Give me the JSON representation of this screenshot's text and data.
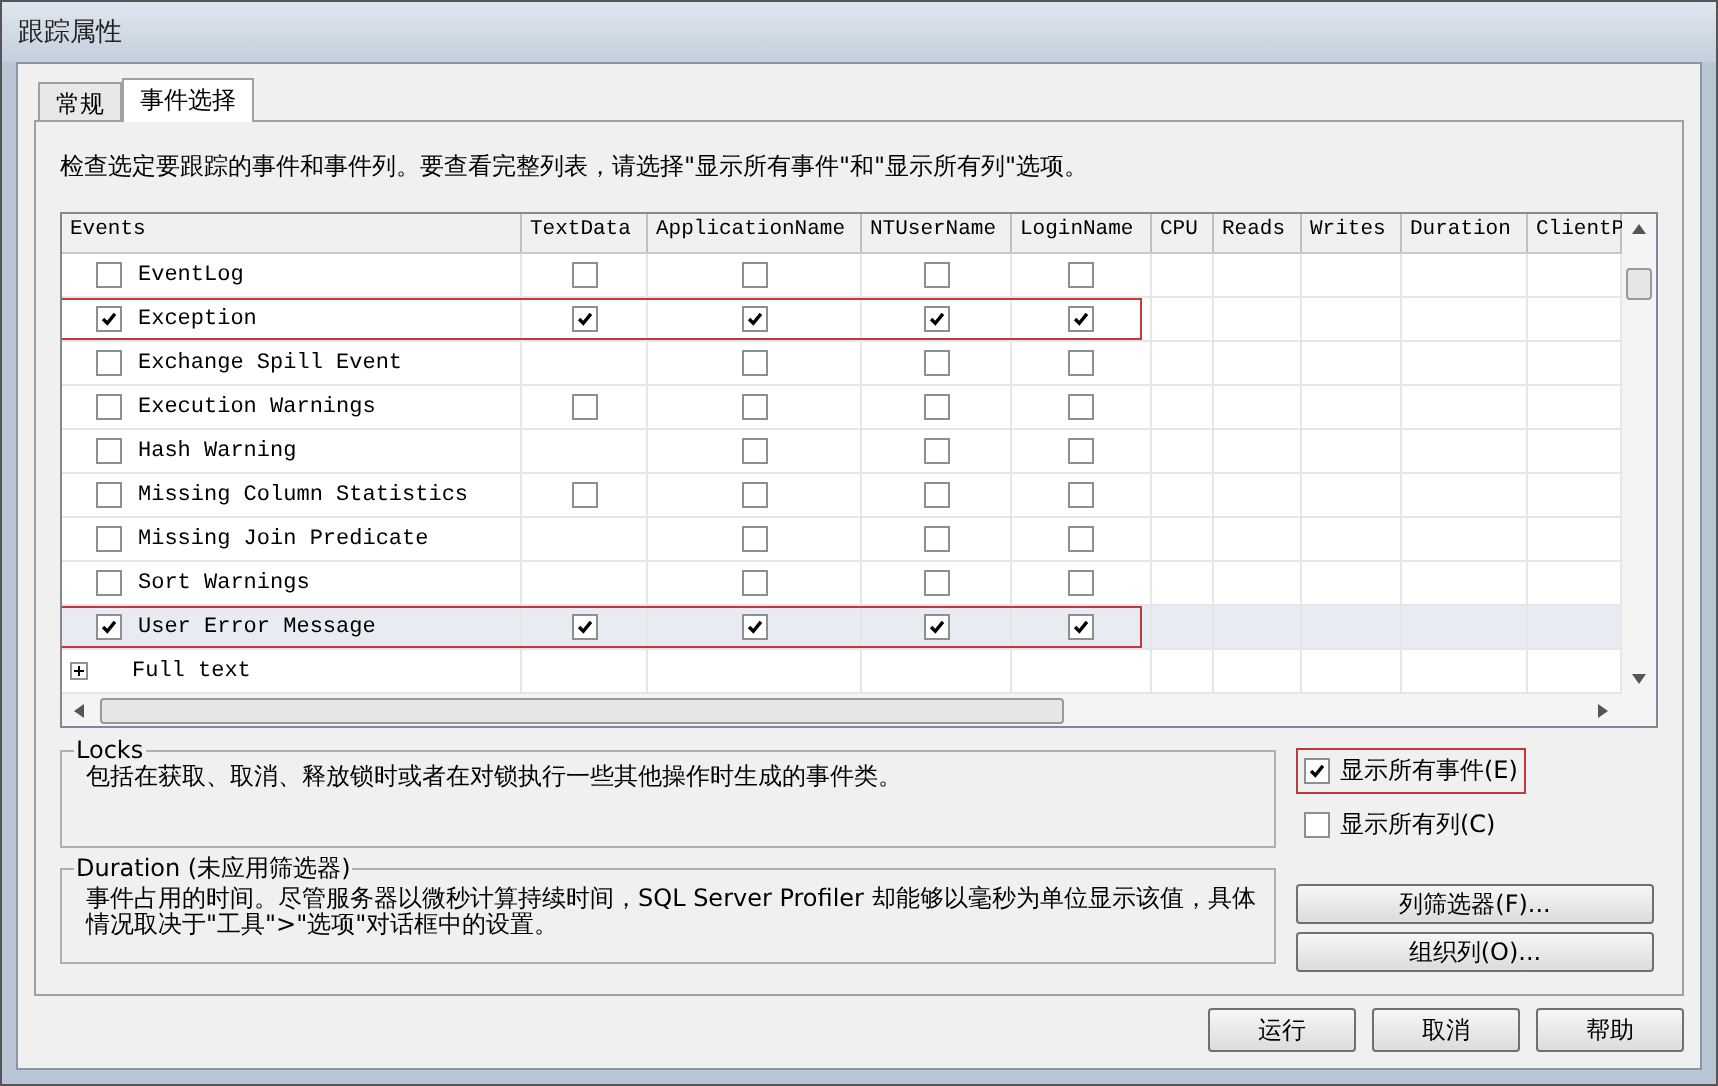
{
  "window": {
    "title": "跟踪属性"
  },
  "tabs": [
    {
      "label": "常规",
      "selected": false
    },
    {
      "label": "事件选择",
      "selected": true
    }
  ],
  "instruction": "检查选定要跟踪的事件和事件列。要查看完整列表，请选择\"显示所有事件\"和\"显示所有列\"选项。",
  "grid": {
    "columns": [
      "Events",
      "TextData",
      "ApplicationName",
      "NTUserName",
      "LoginName",
      "CPU",
      "Reads",
      "Writes",
      "Duration",
      "ClientP"
    ],
    "rows": [
      {
        "kind": "event",
        "name": "EventLog",
        "checked": false,
        "selected": false,
        "highlighted": false,
        "cells": [
          {
            "kind": "checkbox",
            "checked": false
          },
          {
            "kind": "checkbox",
            "checked": false
          },
          {
            "kind": "checkbox",
            "checked": false
          },
          {
            "kind": "checkbox",
            "checked": false
          }
        ]
      },
      {
        "kind": "event",
        "name": "Exception",
        "checked": true,
        "selected": false,
        "highlighted": true,
        "cells": [
          {
            "kind": "checkbox",
            "checked": true
          },
          {
            "kind": "checkbox",
            "checked": true
          },
          {
            "kind": "checkbox",
            "checked": true
          },
          {
            "kind": "checkbox",
            "checked": true
          }
        ]
      },
      {
        "kind": "event",
        "name": "Exchange Spill Event",
        "checked": false,
        "selected": false,
        "highlighted": false,
        "cells": [
          {
            "kind": "empty"
          },
          {
            "kind": "checkbox",
            "checked": false
          },
          {
            "kind": "checkbox",
            "checked": false
          },
          {
            "kind": "checkbox",
            "checked": false
          }
        ]
      },
      {
        "kind": "event",
        "name": "Execution Warnings",
        "checked": false,
        "selected": false,
        "highlighted": false,
        "cells": [
          {
            "kind": "checkbox",
            "checked": false
          },
          {
            "kind": "checkbox",
            "checked": false
          },
          {
            "kind": "checkbox",
            "checked": false
          },
          {
            "kind": "checkbox",
            "checked": false
          }
        ]
      },
      {
        "kind": "event",
        "name": "Hash Warning",
        "checked": false,
        "selected": false,
        "highlighted": false,
        "cells": [
          {
            "kind": "empty"
          },
          {
            "kind": "checkbox",
            "checked": false
          },
          {
            "kind": "checkbox",
            "checked": false
          },
          {
            "kind": "checkbox",
            "checked": false
          }
        ]
      },
      {
        "kind": "event",
        "name": "Missing Column Statistics",
        "checked": false,
        "selected": false,
        "highlighted": false,
        "cells": [
          {
            "kind": "checkbox",
            "checked": false
          },
          {
            "kind": "checkbox",
            "checked": false
          },
          {
            "kind": "checkbox",
            "checked": false
          },
          {
            "kind": "checkbox",
            "checked": false
          }
        ]
      },
      {
        "kind": "event",
        "name": "Missing Join Predicate",
        "checked": false,
        "selected": false,
        "highlighted": false,
        "cells": [
          {
            "kind": "empty"
          },
          {
            "kind": "checkbox",
            "checked": false
          },
          {
            "kind": "checkbox",
            "checked": false
          },
          {
            "kind": "checkbox",
            "checked": false
          }
        ]
      },
      {
        "kind": "event",
        "name": "Sort Warnings",
        "checked": false,
        "selected": false,
        "highlighted": false,
        "cells": [
          {
            "kind": "empty"
          },
          {
            "kind": "checkbox",
            "checked": false
          },
          {
            "kind": "checkbox",
            "checked": false
          },
          {
            "kind": "checkbox",
            "checked": false
          }
        ]
      },
      {
        "kind": "event",
        "name": "User Error Message",
        "checked": true,
        "selected": true,
        "highlighted": true,
        "cells": [
          {
            "kind": "checkbox",
            "checked": true
          },
          {
            "kind": "checkbox",
            "checked": true
          },
          {
            "kind": "checkbox",
            "checked": true
          },
          {
            "kind": "checkbox",
            "checked": true
          }
        ]
      },
      {
        "kind": "category",
        "name": "Full text",
        "expanded": false
      }
    ]
  },
  "locks": {
    "title": "Locks",
    "text": "包括在获取、取消、释放锁时或者在对锁执行一些其他操作时生成的事件类。"
  },
  "duration": {
    "title": "Duration (未应用筛选器)",
    "text": "事件占用的时间。尽管服务器以微秒计算持续时间，SQL Server Profiler 却能够以毫秒为单位显示该值，具体情况取决于\"工具\">\"选项\"对话框中的设置。"
  },
  "options": [
    {
      "label": "显示所有事件(E)",
      "checked": true,
      "highlighted": true
    },
    {
      "label": "显示所有列(C)",
      "checked": false,
      "highlighted": false
    }
  ],
  "side_buttons": [
    "列筛选器(F)...",
    "组织列(O)..."
  ],
  "footer_buttons": [
    "运行",
    "取消",
    "帮助"
  ]
}
